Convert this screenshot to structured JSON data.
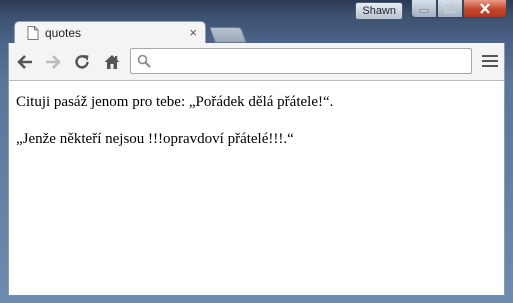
{
  "window": {
    "user_name": "Shawn",
    "buttons": [
      "minimize",
      "maximize",
      "close"
    ]
  },
  "tab": {
    "title": "quotes",
    "icon": "document-icon",
    "close_glyph": "×"
  },
  "toolbar": {
    "icons": [
      "back-arrow-icon",
      "forward-arrow-icon",
      "reload-icon",
      "home-icon",
      "search-icon",
      "menu-icon"
    ],
    "address_value": "",
    "address_placeholder": ""
  },
  "content": {
    "paragraphs": [
      "Cituji pasáž jenom pro tebe: „Pořádek dělá přátele!“.",
      "„Jenže někteří nejsou !!!opravdoví přátelé!!!.“"
    ]
  },
  "colors": {
    "frame": "#4a6286",
    "close_button": "#c2452a",
    "tab_background": "#f4f4f4"
  }
}
